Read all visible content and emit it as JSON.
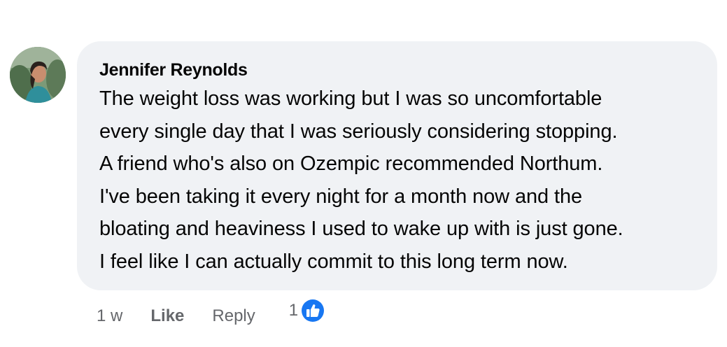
{
  "comment": {
    "author": "Jennifer Reynolds",
    "text": "The weight loss was working but I was so uncomfortable\nevery single day that I was seriously considering stopping.\nA friend who's also on Ozempic recommended Northum.\nI've been taking it every night for a month now and the\nbloating and heaviness I used to wake up with is just gone.\nI feel like I can actually commit to this long term now.",
    "timestamp": "1 w",
    "like_label": "Like",
    "reply_label": "Reply",
    "reaction_count": "1",
    "reaction_icon": "like-thumbs-up-icon",
    "colors": {
      "bubble": "#f0f2f5",
      "text": "#050505",
      "meta": "#65676b",
      "like_blue": "#1877f2"
    }
  }
}
